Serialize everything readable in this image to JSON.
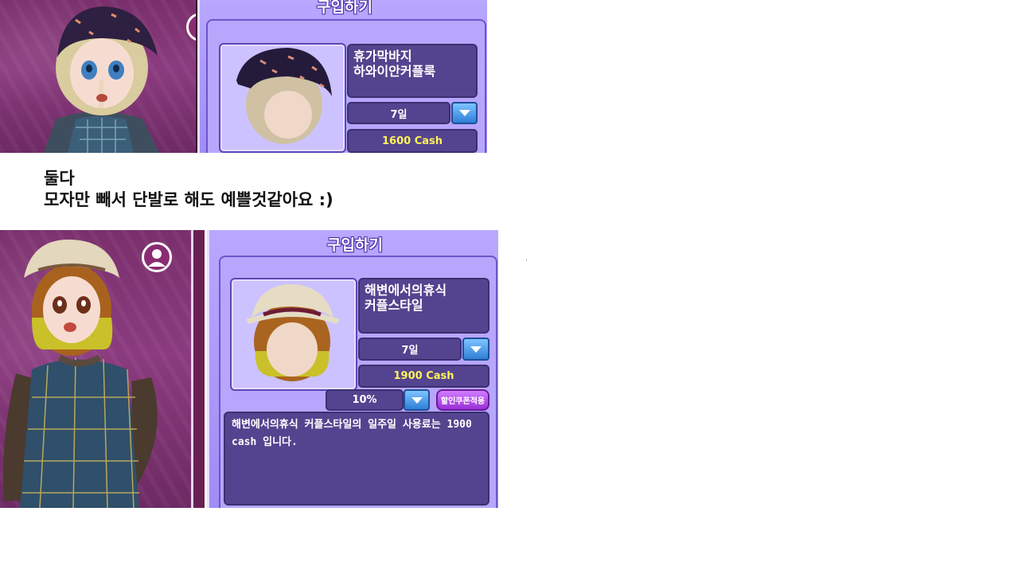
{
  "shot1": {
    "panel_title": "구입하기",
    "item_name": "휴가막바지\n하와이안커플룩",
    "duration": "7일",
    "price": "1600 Cash",
    "icons": [
      "user-avatar-icon",
      "dropdown-arrow-icon"
    ]
  },
  "caption": {
    "line1": "둘다",
    "line2": "모자만 빼서 단발로 해도 예쁠것같아요 :)"
  },
  "shot2": {
    "panel_title": "구입하기",
    "item_name": "해변에서의휴식\n커플스타일",
    "duration": "7일",
    "price": "1900 Cash",
    "discount": "10%",
    "coupon_button": "할인쿠폰적용",
    "description": "해변에서의휴식 커플스타일의 일주일 사용료는 1900 cash 입니다.",
    "icons": [
      "user-avatar-icon",
      "dropdown-arrow-icon"
    ]
  },
  "colors": {
    "panel_bg": "#b9a8ff",
    "box_bg": "#54448f",
    "cash_text": "#fff35a",
    "dropdown_button": "#2f7fd6",
    "scene_bg": "#7a2f6c"
  }
}
